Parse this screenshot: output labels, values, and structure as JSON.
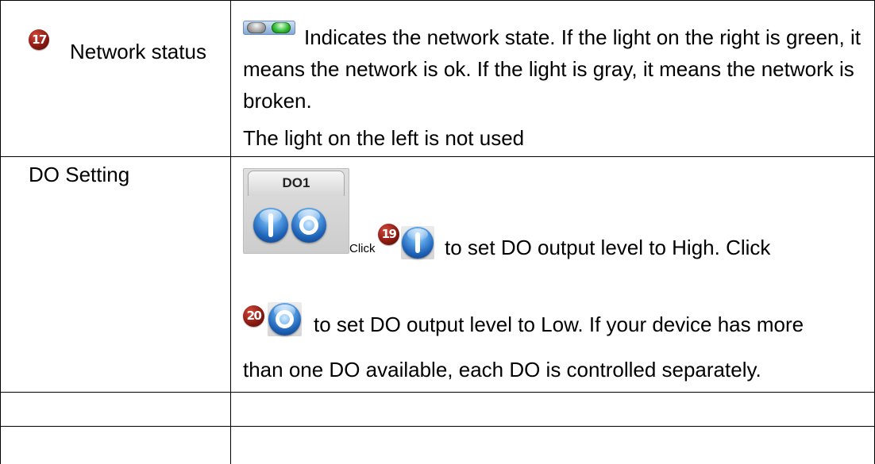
{
  "table": {
    "network_status": {
      "badge": "17",
      "label": "Network status",
      "icon": "network-status-lights-icon",
      "description_lines": [
        "Indicates the network state. If the light on the right is green, it",
        "means the network is ok. If the light is gray, it means the network is",
        "broken."
      ],
      "note": "The light on the left is not used"
    },
    "do_setting": {
      "label": "DO Setting",
      "panel": {
        "title": "DO1",
        "icons": [
          "do-high-button-icon",
          "do-low-button-icon"
        ]
      },
      "click_label": "Click",
      "high": {
        "badge": "19",
        "icon": "do-high-button-icon",
        "text": "to set DO output level to High. Click"
      },
      "low": {
        "badge": "20",
        "icon": "do-low-button-icon",
        "text_lines": [
          "to set DO output level to Low. If your device has more",
          "than one DO available, each DO is controlled separately."
        ]
      }
    }
  },
  "colors": {
    "badge": "#8e1b12",
    "light_on": "#2fb82f",
    "light_off": "#9a9a9a",
    "button_blue": "#1f63b8"
  }
}
